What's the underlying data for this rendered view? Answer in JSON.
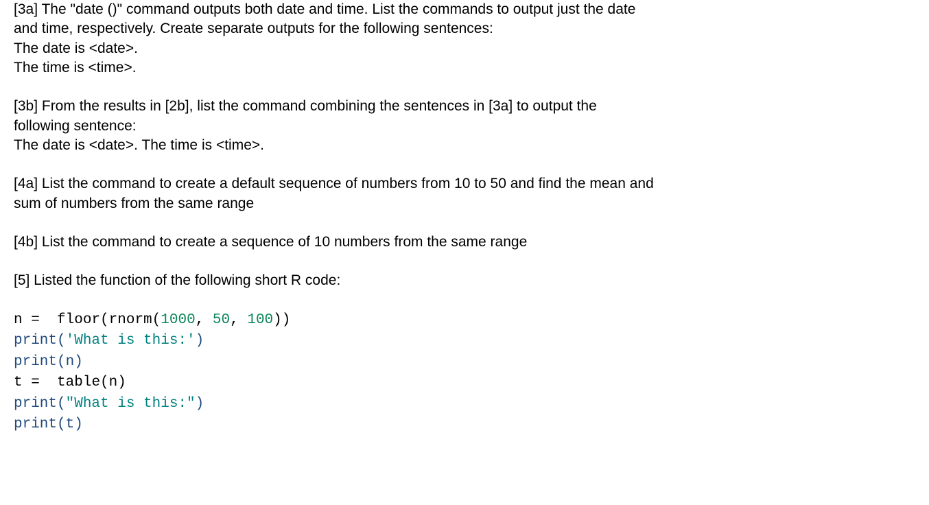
{
  "q3a": {
    "line1": "[3a] The \"date ()\" command outputs both date and time. List the commands to output just the date",
    "line2": "and time, respectively. Create separate outputs for the following sentences:",
    "line3": "The date is <date>.",
    "line4": "The time is <time>."
  },
  "q3b": {
    "line1": "[3b] From the results in [2b], list the command combining the sentences in [3a] to output the",
    "line2": "following sentence:",
    "line3": "The date is <date>. The time is <time>."
  },
  "q4a": {
    "line1": "[4a] List the command to create a default sequence of numbers from 10 to 50 and find the mean and",
    "line2": "sum of numbers from the same range"
  },
  "q4b": {
    "line1": "[4b] List the command to create a sequence of 10 numbers from the same range"
  },
  "q5": {
    "line1": "[5] Listed the function of the following short R code:"
  },
  "code": {
    "l1a": "n ",
    "l1b": "=",
    "l1c": "  floor(rnorm(",
    "l1d": "1000",
    "l1e": ", ",
    "l1f": "50",
    "l1g": ", ",
    "l1h": "100",
    "l1i": "))",
    "l2a": "print(",
    "l2b": "'What is this:'",
    "l2c": ")",
    "l3a": "print(n)",
    "l4a": "t ",
    "l4b": "=",
    "l4c": "  table(n)",
    "l5a": "print(",
    "l5b": "\"What is this:\"",
    "l5c": ")",
    "l6a": "print(t)"
  }
}
